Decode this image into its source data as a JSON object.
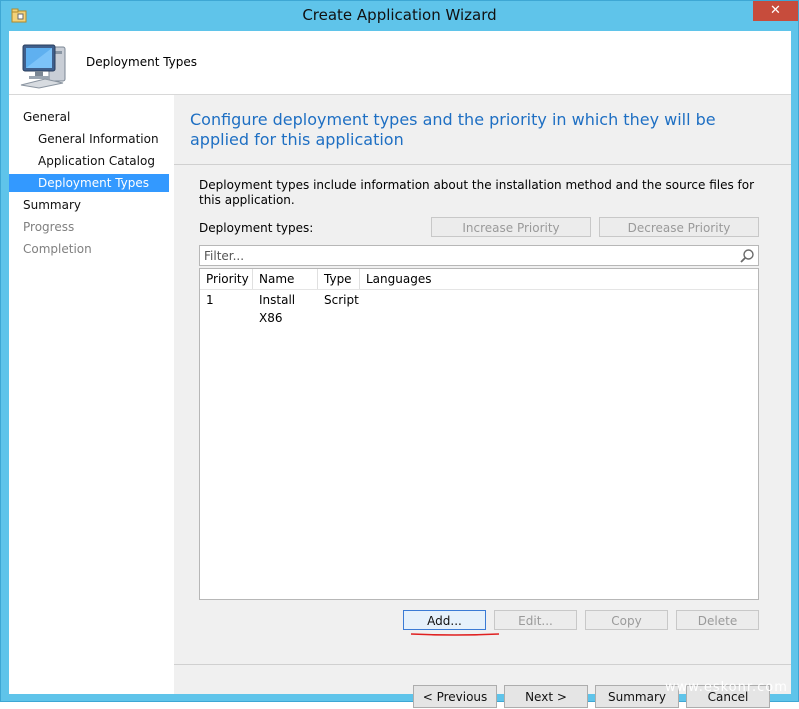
{
  "window": {
    "title": "Create Application Wizard",
    "close_label": "✕"
  },
  "header": {
    "title": "Deployment Types",
    "icon": "computer-icon"
  },
  "nav": {
    "items": [
      {
        "label": "General",
        "state": "normal"
      },
      {
        "label": "General Information",
        "state": "normal"
      },
      {
        "label": "Application Catalog",
        "state": "normal"
      },
      {
        "label": "Deployment Types",
        "state": "selected"
      },
      {
        "label": "Summary",
        "state": "normal"
      },
      {
        "label": "Progress",
        "state": "disabled"
      },
      {
        "label": "Completion",
        "state": "disabled"
      }
    ]
  },
  "main": {
    "heading": "Configure deployment types and the priority in which they will be applied for this application",
    "description": "Deployment types include information about the installation method and the source files for this application.",
    "deployment_types_label": "Deployment types:",
    "increase_priority": "Increase Priority",
    "decrease_priority": "Decrease Priority",
    "filter_placeholder": "Filter...",
    "columns": [
      "Priority",
      "Name",
      "Type",
      "Languages"
    ],
    "rows": [
      {
        "priority": "1",
        "name": "Install X86",
        "type": "Script",
        "languages": ""
      }
    ],
    "add": "Add...",
    "edit": "Edit...",
    "copy": "Copy",
    "delete": "Delete"
  },
  "footer": {
    "previous": "< Previous",
    "next": "Next >",
    "summary": "Summary",
    "cancel": "Cancel"
  },
  "watermark": "www.eskonr.com",
  "colors": {
    "frame": "#5fc4ea",
    "accent_heading": "#1e6fc3",
    "selection": "#3399ff",
    "annotation_underline": "#e02020"
  }
}
